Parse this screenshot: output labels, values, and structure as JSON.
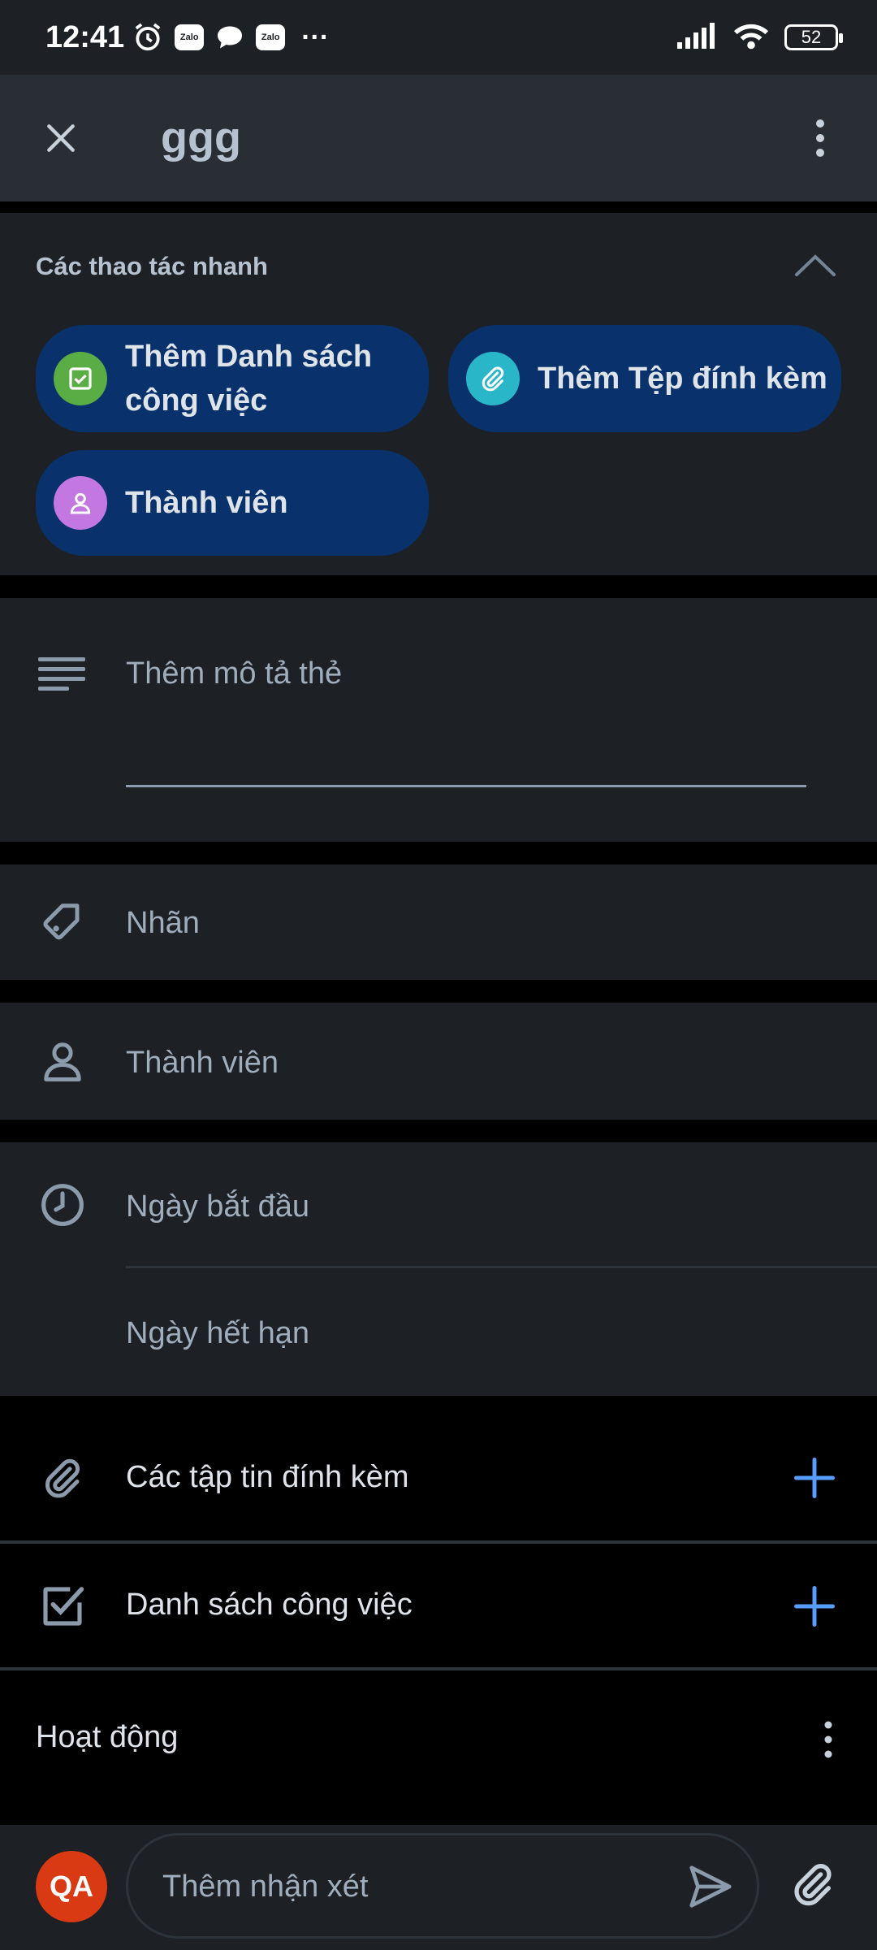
{
  "status_bar": {
    "time": "12:41",
    "notif_zalo_1": "Zalo",
    "notif_zalo_2": "Zalo",
    "overflow": "···",
    "battery": "52"
  },
  "header": {
    "title": "ggg"
  },
  "quick_actions": {
    "title": "Các thao tác nhanh",
    "chips": [
      {
        "label": "Thêm Danh sách công việc",
        "color": "#5aac44"
      },
      {
        "label": "Thêm Tệp đính kèm",
        "color": "#29b6c9"
      },
      {
        "label": "Thành viên",
        "color": "#c377e0"
      }
    ]
  },
  "description": {
    "placeholder": "Thêm mô tả thẻ"
  },
  "labels": {
    "text": "Nhãn"
  },
  "members": {
    "text": "Thành viên"
  },
  "dates": {
    "start": "Ngày bắt đầu",
    "due": "Ngày hết hạn"
  },
  "attachments": {
    "label": "Các tập tin đính kèm"
  },
  "checklist": {
    "label": "Danh sách công việc"
  },
  "activity": {
    "label": "Hoạt động"
  },
  "comment": {
    "avatar_initials": "QA",
    "placeholder": "Thêm nhận xét"
  },
  "colors": {
    "accent": "#579dff",
    "surface": "#1d2125",
    "chip_bg": "#09326c"
  }
}
